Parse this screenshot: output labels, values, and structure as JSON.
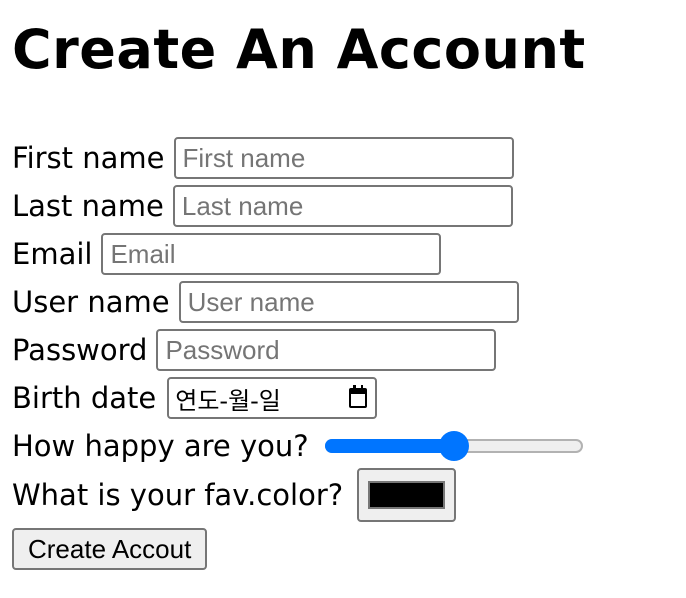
{
  "page": {
    "title": "Create An Account"
  },
  "form": {
    "first_name": {
      "label": "First name",
      "placeholder": "First name"
    },
    "last_name": {
      "label": "Last name",
      "placeholder": "Last name"
    },
    "email": {
      "label": "Email",
      "placeholder": "Email"
    },
    "user_name": {
      "label": "User name",
      "placeholder": "User name"
    },
    "password": {
      "label": "Password",
      "placeholder": "Password"
    },
    "birth_date": {
      "label": "Birth date",
      "placeholder": "연도-월-일"
    },
    "happiness": {
      "label": "How happy are you?",
      "value_fraction": 0.5
    },
    "fav_color": {
      "label": "What is your fav.color?",
      "value": "#000000"
    },
    "submit_label": "Create Accout"
  },
  "colors": {
    "accent": "#0075ff",
    "border": "#767676",
    "button_bg": "#efefef"
  },
  "icons": {
    "date_picker": "calendar-icon"
  }
}
